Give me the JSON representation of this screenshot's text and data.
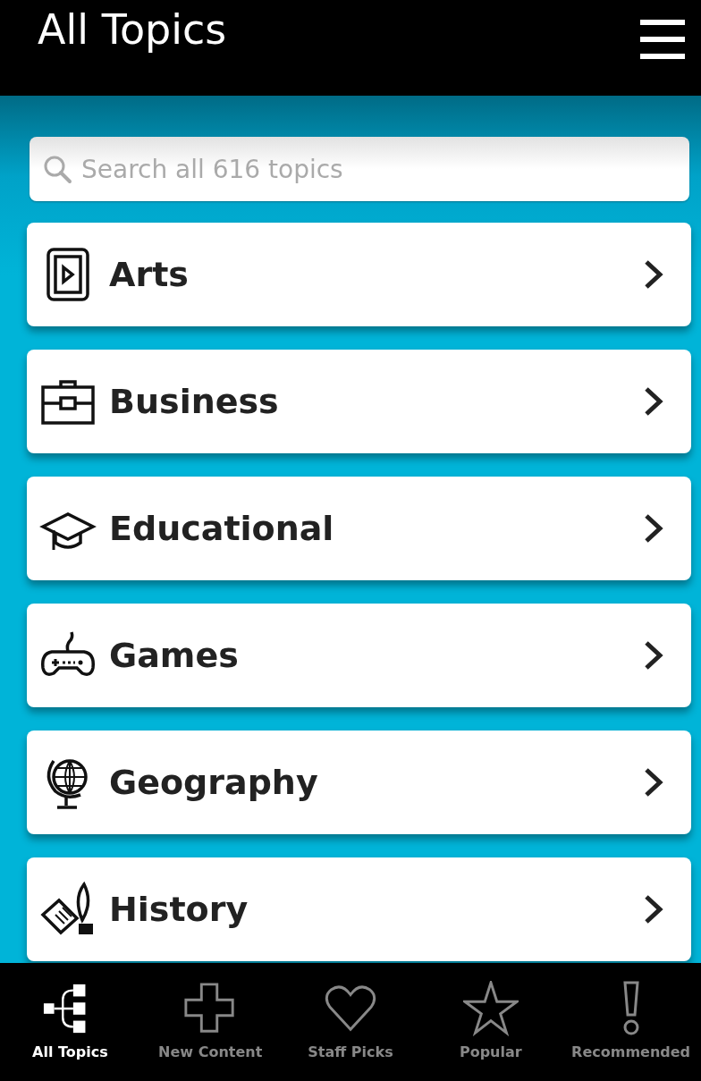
{
  "header": {
    "title": "All Topics"
  },
  "search": {
    "placeholder": "Search all 616 topics"
  },
  "topics": [
    {
      "kind": "frame",
      "label": "Arts"
    },
    {
      "kind": "briefcase",
      "label": "Business"
    },
    {
      "kind": "cap",
      "label": "Educational"
    },
    {
      "kind": "gamepad",
      "label": "Games"
    },
    {
      "kind": "globe",
      "label": "Geography"
    },
    {
      "kind": "quill",
      "label": "History"
    }
  ],
  "tabs": [
    {
      "kind": "tree",
      "label": "All Topics",
      "selected": true
    },
    {
      "kind": "plus",
      "label": "New Content",
      "selected": false
    },
    {
      "kind": "heart",
      "label": "Staff Picks",
      "selected": false
    },
    {
      "kind": "star",
      "label": "Popular",
      "selected": false
    },
    {
      "kind": "exclaim",
      "label": "Recommended",
      "selected": false
    }
  ]
}
